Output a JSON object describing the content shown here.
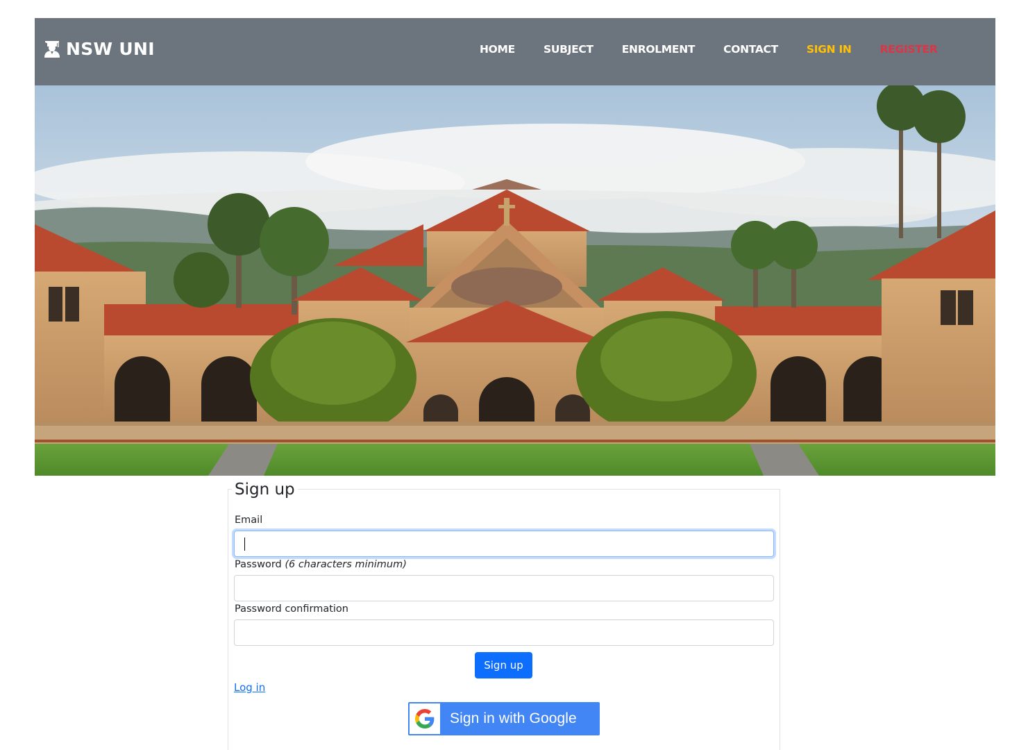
{
  "navbar": {
    "brand": "NSW UNI",
    "brand_icon": "graduate-icon",
    "links": {
      "home": "HOME",
      "subject": "SUBJECT",
      "enrolment": "ENROLMENT",
      "contact": "CONTACT",
      "signin": "SIGN IN",
      "register": "REGISTER"
    },
    "colors": {
      "background": "#6c757d",
      "signin": "#ffc107",
      "register": "#dc3545"
    }
  },
  "form": {
    "legend": "Sign up",
    "email_label": "Email",
    "email_value": "",
    "password_label": "Password",
    "password_hint": "(6 characters minimum)",
    "password_value": "",
    "confirmation_label": "Password confirmation",
    "confirmation_value": "",
    "submit_label": "Sign up",
    "login_link": "Log in",
    "google_button": "Sign in with Google",
    "colors": {
      "primary": "#0d6efd",
      "google": "#4285f4"
    }
  }
}
